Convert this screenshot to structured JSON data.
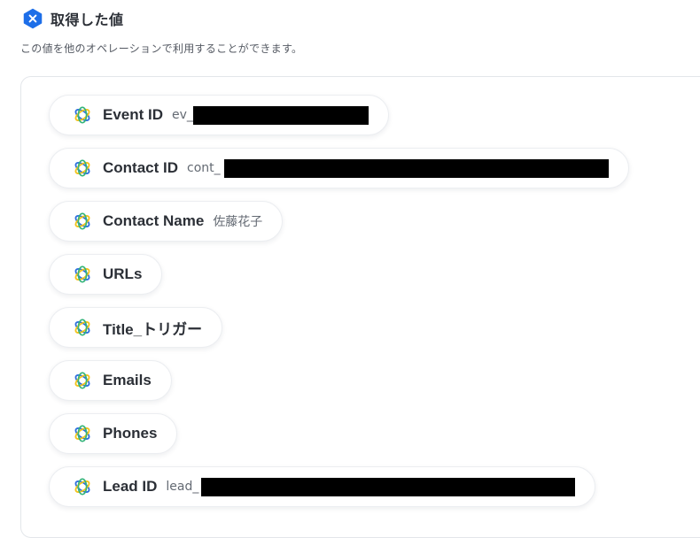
{
  "header": {
    "badge_icon": "yoom-x-badge-icon",
    "badge_color": "#1d6ee8",
    "title": "取得した値"
  },
  "subtitle": "この値を他のオペレーションで利用することができます。",
  "fields": [
    {
      "label": "Event ID",
      "value": "ev_",
      "redacted": true
    },
    {
      "label": "Contact ID",
      "value": "cont_",
      "redacted": true
    },
    {
      "label": "Contact Name",
      "value": "佐藤花子",
      "redacted": false
    },
    {
      "label": "URLs",
      "value": "",
      "redacted": false
    },
    {
      "label": "Title_トリガー",
      "value": "",
      "redacted": false
    },
    {
      "label": "Emails",
      "value": "",
      "redacted": false
    },
    {
      "label": "Phones",
      "value": "",
      "redacted": false
    },
    {
      "label": "Lead ID",
      "value": "lead_",
      "redacted": true
    }
  ],
  "field_icon": "atom-orbit-icon",
  "colors": {
    "orbit_blue": "#2f6fde",
    "orbit_yellow": "#f2c21b",
    "orbit_green": "#34b47a",
    "redaction": "#000000"
  }
}
